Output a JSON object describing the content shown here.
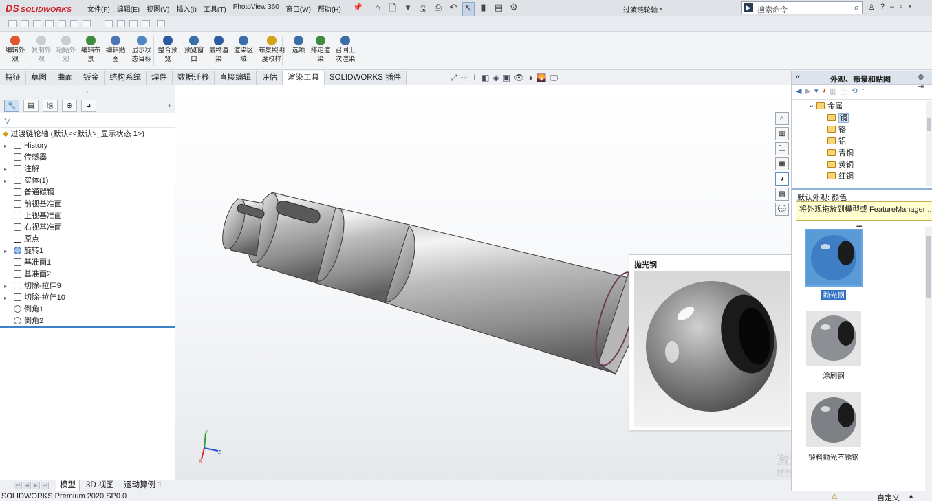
{
  "app": {
    "logo_prefix": "DS",
    "logo_text": "SOLIDWORKS",
    "menu": [
      "文件(F)",
      "编辑(E)",
      "视图(V)",
      "插入(I)",
      "工具(T)",
      "PhotoView 360",
      "窗口(W)",
      "帮助(H)"
    ],
    "document_title": "过渡链轮轴 *",
    "search_placeholder": "搜索命令"
  },
  "ribbon": [
    {
      "line1": "编辑外",
      "line2": "观",
      "enabled": true,
      "icon": "appearance-icon",
      "color": "#e0552b"
    },
    {
      "line1": "复制外",
      "line2": "观",
      "enabled": false,
      "icon": "copy-appearance-icon",
      "color": "#c9cdd3"
    },
    {
      "line1": "粘贴外",
      "line2": "观",
      "enabled": false,
      "icon": "paste-appearance-icon",
      "color": "#c9cdd3"
    },
    {
      "line1": "编辑布",
      "line2": "景",
      "enabled": true,
      "icon": "scene-icon",
      "color": "#3f8b3f"
    },
    {
      "line1": "编辑贴",
      "line2": "图",
      "enabled": true,
      "icon": "decal-icon",
      "color": "#4b78b5"
    },
    {
      "line1": "显示状",
      "line2": "态目标",
      "enabled": true,
      "icon": "target-icon",
      "color": "#4f86c6"
    },
    {
      "line1": "整合预",
      "line2": "览",
      "enabled": true,
      "icon": "integrated-preview-icon",
      "color": "#2c5d9e"
    },
    {
      "line1": "预览窗",
      "line2": "口",
      "enabled": true,
      "icon": "preview-window-icon",
      "color": "#3a6ea8"
    },
    {
      "line1": "最终渲",
      "line2": "染",
      "enabled": true,
      "icon": "final-render-icon",
      "color": "#2c5d9e"
    },
    {
      "line1": "渲染区",
      "line2": "域",
      "enabled": true,
      "icon": "render-region-icon",
      "color": "#3a6ea8"
    },
    {
      "line1": "布景照明",
      "line2": "度校样",
      "enabled": true,
      "icon": "scene-illumination-icon",
      "color": "#d6a21b"
    },
    {
      "line1": "选项",
      "line2": "",
      "enabled": true,
      "icon": "options-icon",
      "color": "#3a6ea8"
    },
    {
      "line1": "排定渲",
      "line2": "染",
      "enabled": true,
      "icon": "schedule-render-icon",
      "color": "#3f8b3f"
    },
    {
      "line1": "召回上",
      "line2": "次渲染",
      "enabled": true,
      "icon": "recall-render-icon",
      "color": "#3a6ea8"
    }
  ],
  "tabs": [
    "特征",
    "草图",
    "曲面",
    "钣金",
    "结构系统",
    "焊件",
    "数据迁移",
    "直接编辑",
    "评估",
    "渲染工具",
    "SOLIDWORKS 插件"
  ],
  "active_tab": "渲染工具",
  "feature_tree": {
    "root": "过渡链轮轴  (默认<<默认>_显示状态 1>)",
    "items": [
      {
        "label": "History",
        "expand": true,
        "icon": "history-icon"
      },
      {
        "label": "传感器",
        "expand": false,
        "icon": "sensor-icon"
      },
      {
        "label": "注解",
        "expand": true,
        "icon": "annotation-icon"
      },
      {
        "label": "实体(1)",
        "expand": true,
        "icon": "solid-body-icon"
      },
      {
        "label": "普通碳钢",
        "expand": false,
        "icon": "material-icon"
      },
      {
        "label": "前视基准面",
        "expand": false,
        "icon": "plane-icon"
      },
      {
        "label": "上视基准面",
        "expand": false,
        "icon": "plane-icon"
      },
      {
        "label": "右视基准面",
        "expand": false,
        "icon": "plane-icon"
      },
      {
        "label": "原点",
        "expand": false,
        "icon": "origin-icon"
      },
      {
        "label": "旋转1",
        "expand": true,
        "icon": "revolve-icon"
      },
      {
        "label": "基准面1",
        "expand": false,
        "icon": "plane-icon"
      },
      {
        "label": "基准面2",
        "expand": false,
        "icon": "plane-icon"
      },
      {
        "label": "切除-拉伸9",
        "expand": true,
        "icon": "cut-extrude-icon"
      },
      {
        "label": "切除-拉伸10",
        "expand": true,
        "icon": "cut-extrude-icon"
      },
      {
        "label": "倒角1",
        "expand": false,
        "icon": "chamfer-icon"
      },
      {
        "label": "倒角2",
        "expand": false,
        "icon": "chamfer-icon"
      }
    ]
  },
  "bottom_tabs": [
    "模型",
    "3D 视图",
    "运动算例 1"
  ],
  "status": {
    "left": "SOLIDWORKS Premium 2020 SP0.0",
    "right": "自定义"
  },
  "preview": {
    "title": "抛光钢"
  },
  "watermark": {
    "line1": "激活 Windows",
    "line2": "转到\"设置\"以激活 Windows。"
  },
  "right_panel": {
    "title": "外观、布景和贴图",
    "tree": [
      {
        "label": "金属",
        "level": 0,
        "selected": false
      },
      {
        "label": "钢",
        "level": 1,
        "selected": true
      },
      {
        "label": "铬",
        "level": 1,
        "selected": false
      },
      {
        "label": "铝",
        "level": 1,
        "selected": false
      },
      {
        "label": "青铜",
        "level": 1,
        "selected": false
      },
      {
        "label": "黄铜",
        "level": 1,
        "selected": false
      },
      {
        "label": "红铜",
        "level": 1,
        "selected": false
      }
    ],
    "info": "默认外观: 颜色",
    "tip": "将外观拖放到模型或 FeatureManager ...",
    "swatches": [
      {
        "label": "抛光钢",
        "selected": true,
        "tint": "#3f7ec4"
      },
      {
        "label": "涂刷钢",
        "selected": false,
        "tint": "#8c8f93"
      },
      {
        "label": "锻料抛光不锈钢",
        "selected": false,
        "tint": "#7d8084"
      }
    ]
  },
  "colors": {
    "accent": "#2f6fc6",
    "brand_red": "#d21f26",
    "tooltip_bg": "#ffffd0"
  }
}
